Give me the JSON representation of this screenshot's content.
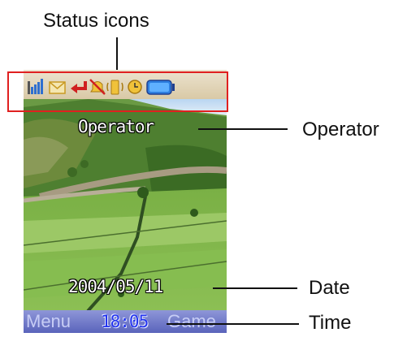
{
  "callouts": {
    "status_icons": "Status icons",
    "operator": "Operator",
    "date": "Date",
    "time": "Time"
  },
  "screen": {
    "operator_name": "Operator",
    "date": "2004/05/11",
    "time": "18:05",
    "left_softkey": "Menu",
    "right_softkey": "Game"
  },
  "status_icons": [
    "signal-strength-icon",
    "message-envelope-icon",
    "missed-call-icon",
    "silent-mode-icon",
    "vibrate-icon",
    "alarm-clock-icon",
    "battery-icon"
  ],
  "colors": {
    "highlight_frame": "#e02020",
    "softbar": "#6a74c8",
    "clock": "#2233ee"
  }
}
